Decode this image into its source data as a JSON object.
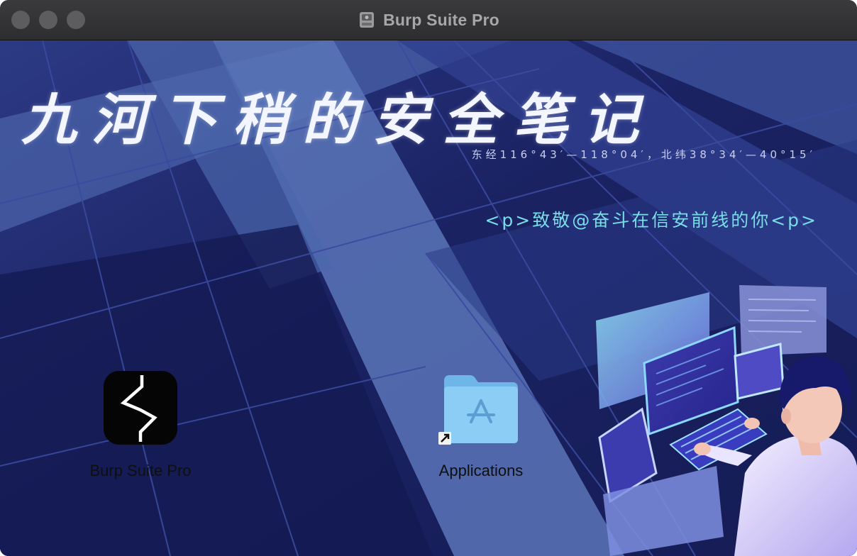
{
  "window": {
    "title": "Burp Suite Pro",
    "title_icon": "disk-image-icon"
  },
  "banner": {
    "title": "九河下稍的安全笔记",
    "coords": "东经116°43′—118°04′，北纬38°34′—40°15′",
    "slogan": "<p>致敬@奋斗在信安前线的你<p>"
  },
  "items": [
    {
      "label": "Burp Suite Pro",
      "icon": "burp-suite-app-icon"
    },
    {
      "label": "Applications",
      "icon": "applications-folder-icon"
    }
  ],
  "colors": {
    "background": "#1c2566",
    "accent_text": "#79dde6",
    "title_bar": "#353537"
  }
}
